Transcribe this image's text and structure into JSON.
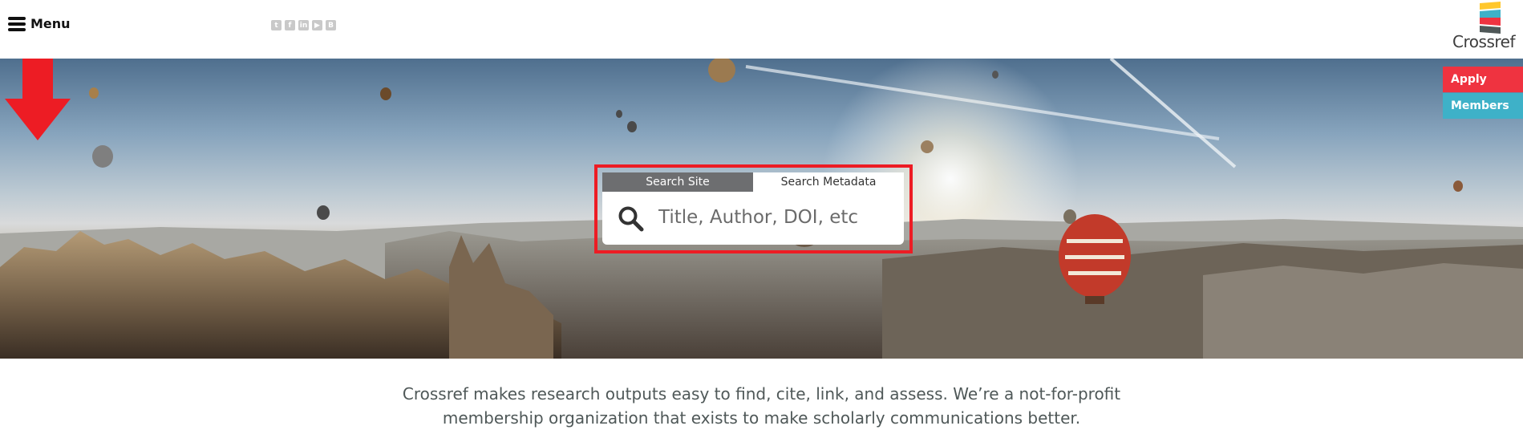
{
  "header": {
    "menu_label": "Menu",
    "menu_icon": "hamburger-icon",
    "social_icons": [
      {
        "name": "twitter-icon",
        "glyph": "t"
      },
      {
        "name": "facebook-icon",
        "glyph": "f"
      },
      {
        "name": "linkedin-icon",
        "glyph": "in"
      },
      {
        "name": "youtube-icon",
        "glyph": "▶"
      },
      {
        "name": "blog-icon",
        "glyph": "B"
      }
    ],
    "logo_text": "Crossref"
  },
  "side_buttons": {
    "apply": "Apply",
    "members": "Members"
  },
  "search": {
    "tab_site": "Search Site",
    "tab_metadata": "Search Metadata",
    "placeholder": "Title, Author, DOI, etc"
  },
  "tagline": {
    "line1": "Crossref makes research outputs easy to find, cite, link, and assess. We’re a not-for-profit",
    "line2": "membership organization that exists to make scholarly communications better."
  },
  "colors": {
    "apply": "#ef3340",
    "members": "#3eb1c8",
    "highlight": "#ed1c24",
    "tab_active": "#6d6e70"
  }
}
